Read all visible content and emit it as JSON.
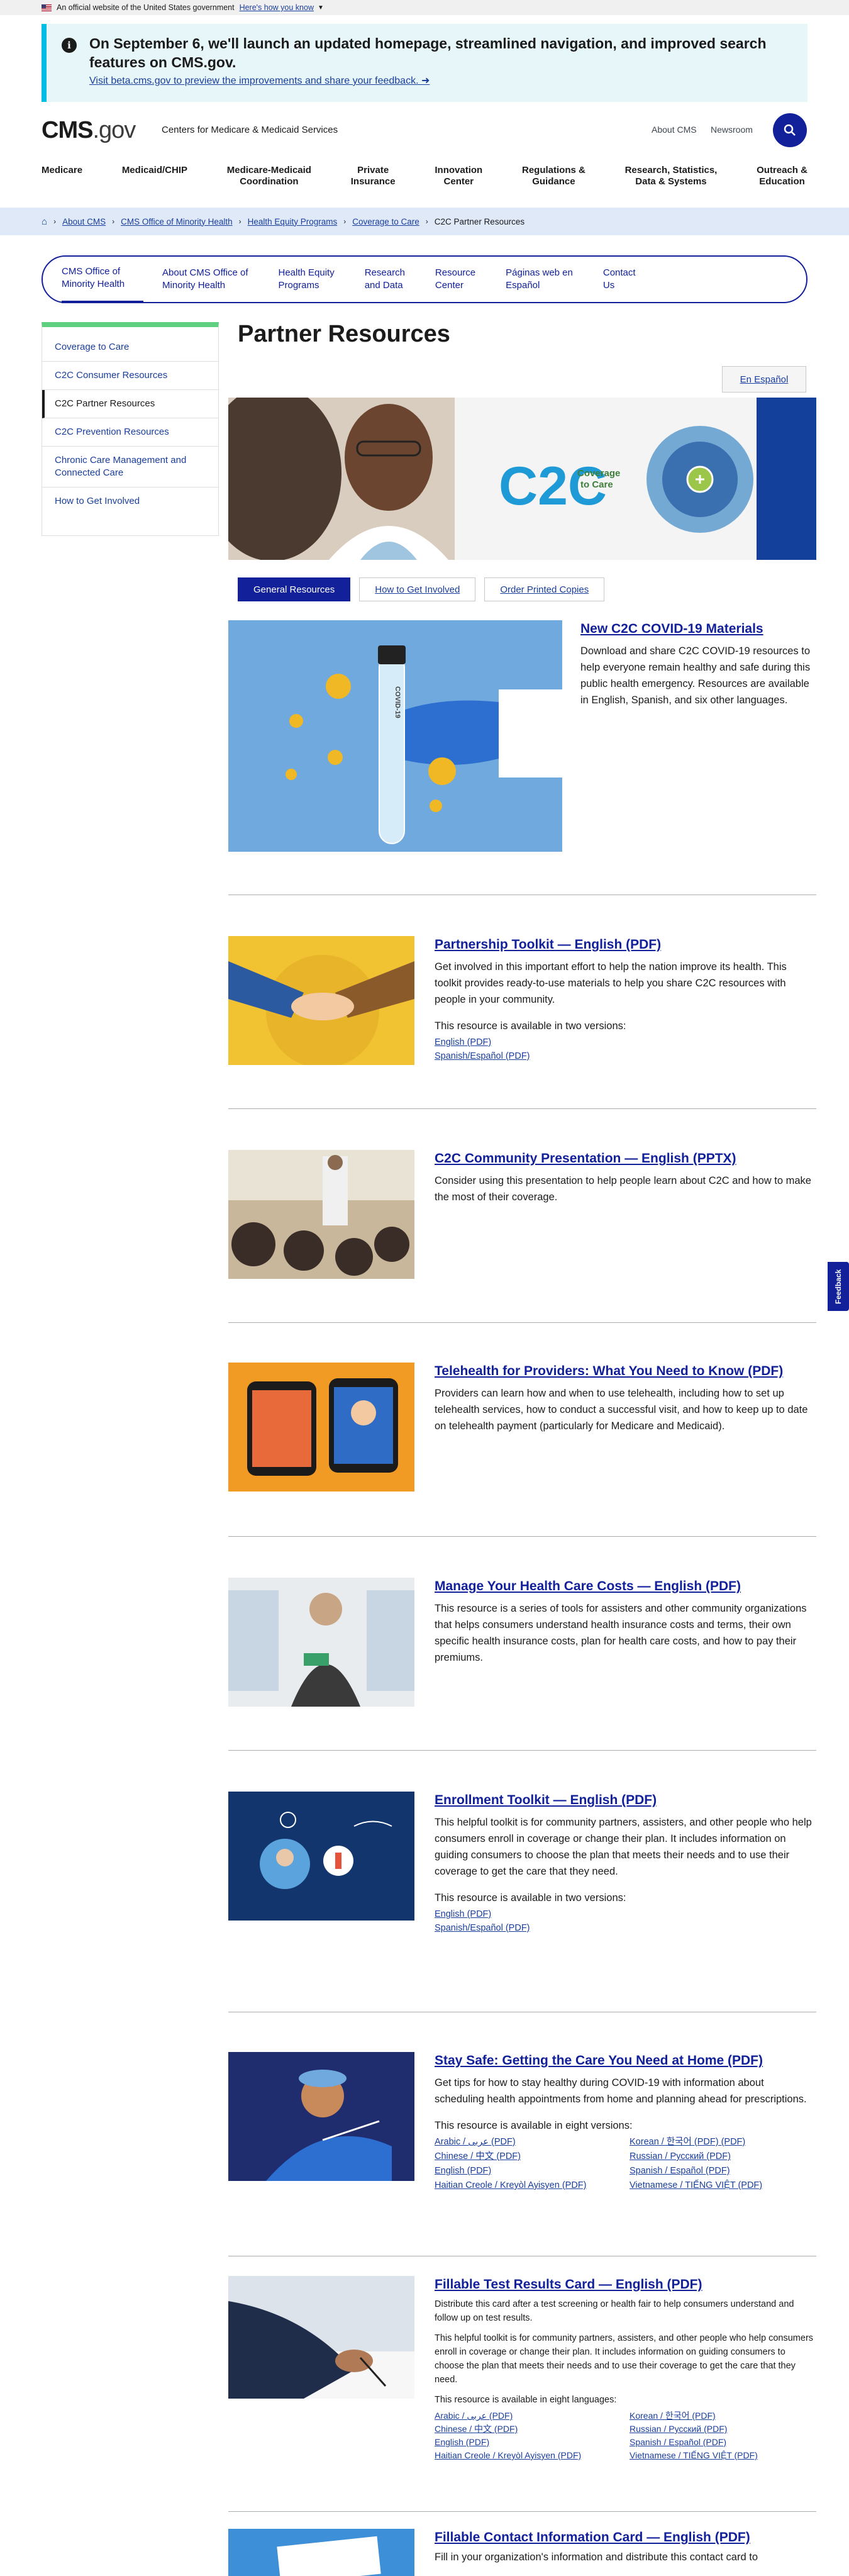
{
  "gov_banner": {
    "text": "An official website of the United States government",
    "link": "Here's how you know"
  },
  "alert": {
    "heading": "On September 6, we'll launch an updated homepage, streamlined navigation, and improved search features on CMS.gov.",
    "link": "Visit beta.cms.gov to preview the improvements and share your feedback."
  },
  "header": {
    "logo_main": "CMS",
    "logo_suffix": ".gov",
    "tagline": "Centers for Medicare & Medicaid Services",
    "about": "About CMS",
    "newsroom": "Newsroom"
  },
  "main_nav": [
    "Medicare",
    "Medicaid/CHIP",
    "Medicare-Medicaid\nCoordination",
    "Private\nInsurance",
    "Innovation\nCenter",
    "Regulations &\nGuidance",
    "Research, Statistics,\nData & Systems",
    "Outreach &\nEducation"
  ],
  "breadcrumbs": [
    "About CMS",
    "CMS Office of Minority Health",
    "Health Equity Programs",
    "Coverage to Care",
    "C2C Partner Resources"
  ],
  "sub_nav": [
    "CMS Office of\nMinority Health",
    "About CMS Office of\nMinority Health",
    "Health Equity\nPrograms",
    "Research\nand Data",
    "Resource\nCenter",
    "Páginas web en\nEspañol",
    "Contact\nUs"
  ],
  "side_nav": [
    "Coverage to Care",
    "C2C Consumer Resources",
    "C2C Partner Resources",
    "C2C Prevention Resources",
    "Chronic Care Management and Connected Care",
    "How to Get Involved"
  ],
  "page_title": "Partner Resources",
  "espanol": "En Español",
  "hero": {
    "logo_text": "C2C",
    "logo_sub": "Coverage\nto Care"
  },
  "tabs": [
    "General Resources",
    "How to Get Involved",
    "Order Printed Copies"
  ],
  "covid": {
    "title": "New C2C COVID-19 Materials",
    "desc": "Download and share C2C COVID-19 resources to help everyone remain healthy and safe during this public health emergency. Resources are available in English, Spanish, and six other languages.",
    "tube_label": "COVID-19"
  },
  "resources": [
    {
      "title": "Partnership Toolkit — English (PDF)",
      "desc": "Get involved in this important effort to help the nation improve its health. This toolkit provides ready-to-use materials to help you share C2C resources with people in your community.",
      "avail": "This resource is available in two versions:",
      "links": [
        "English (PDF)",
        "Spanish/Español (PDF)"
      ]
    },
    {
      "title": "C2C Community Presentation — English (PPTX)",
      "desc": "Consider using this presentation to help people learn about C2C and how to make the most of their coverage."
    },
    {
      "title": "Telehealth for Providers: What You Need to Know (PDF)",
      "desc": "Providers can learn how and when to use telehealth, including how to set up telehealth services, how to conduct a successful visit, and how to keep up to date on telehealth payment (particularly for Medicare and Medicaid)."
    },
    {
      "title": "Manage Your Health Care Costs — English (PDF)",
      "desc": "This resource is a series of tools for assisters and other community organizations that helps consumers understand health insurance costs and terms, their own specific health insurance costs, plan for health care costs, and how to pay their premiums."
    },
    {
      "title": "Enrollment Toolkit — English (PDF)",
      "desc": "This helpful toolkit is for community partners, assisters, and other people who help consumers enroll in coverage or change their plan. It includes information on guiding consumers to choose the plan that meets their needs and to use their coverage to get the care that they need.",
      "avail": "This resource is available in two versions:",
      "links": [
        "English (PDF)",
        "Spanish/Español (PDF)"
      ]
    },
    {
      "title": "Stay Safe: Getting the Care You Need at Home (PDF)",
      "desc": "Get tips for how to stay healthy during COVID-19 with information about scheduling health appointments from home and planning ahead for prescriptions.",
      "avail": "This resource is available in eight versions:",
      "links": [
        "Arabic / عربى (PDF)",
        "Korean / 한국어 (PDF) (PDF)",
        "Chinese / 中文 (PDF)",
        "Russian / Русский (PDF)",
        "English (PDF)",
        "Spanish / Español (PDF)",
        "Haitian Creole / Kreyòl Ayisyen (PDF)",
        "Vietnamese / TIẾNG VIỆT (PDF)"
      ]
    },
    {
      "title": "Fillable Test Results Card — English (PDF)",
      "desc": "Distribute this card after a test screening or health fair to help consumers understand and follow up on test results.",
      "desc2": "This helpful toolkit is for community partners, assisters, and other people who help consumers enroll in coverage or change their plan. It includes information on guiding consumers to choose the plan that meets their needs and to use their coverage to get the care that they need.",
      "avail": "This resource is available in eight languages:",
      "links": [
        "Arabic / عربى (PDF)",
        "Korean / 한국어 (PDF)",
        "Chinese / 中文 (PDF)",
        "Russian / Русский (PDF)",
        "English (PDF)",
        "Spanish / Español (PDF)",
        "Haitian Creole / Kreyòl Ayisyen (PDF)",
        "Vietnamese / TIẾNG VIỆT (PDF)"
      ]
    },
    {
      "title": "Fillable Contact Information Card — English (PDF)",
      "desc": "Fill in your organization's information and distribute this contact card to"
    }
  ],
  "feedback": "Feedback",
  "colors": {
    "brand": "#12209a",
    "alert_bg": "#e7f6f8",
    "alert_border": "#00bde3",
    "crumb_bg": "#dfe9f8",
    "side_accent": "#5fd07f"
  }
}
